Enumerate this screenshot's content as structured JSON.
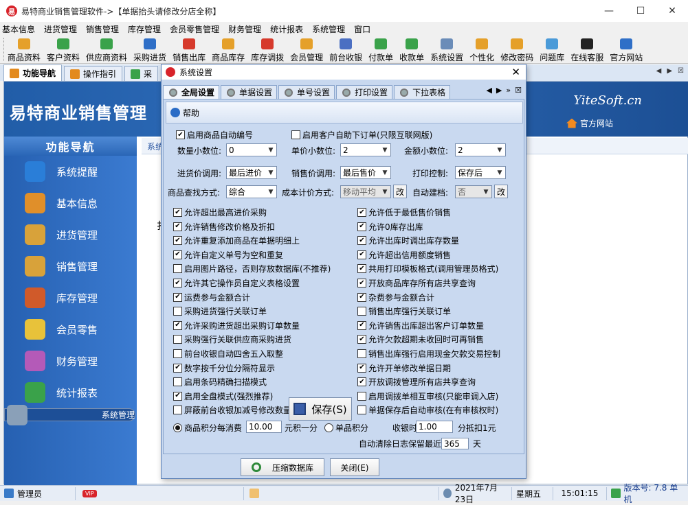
{
  "app": {
    "title": "易特商业销售管理软件->【单据抬头请修改分店全称】"
  },
  "menu": [
    "基本信息",
    "进货管理",
    "销售管理",
    "库存管理",
    "会员零售管理",
    "财务管理",
    "统计报表",
    "系统管理",
    "窗口"
  ],
  "toolbar": {
    "items": [
      {
        "label": "商品资料",
        "color": "#e5a02a"
      },
      {
        "label": "客户资料",
        "color": "#3aa24a"
      },
      {
        "label": "供应商资料",
        "color": "#3aa24a"
      },
      {
        "label": "采购进货",
        "color": "#2f6fc7"
      },
      {
        "label": "销售出库",
        "color": "#d63a2c"
      },
      {
        "label": "商品库存",
        "color": "#e5a02a"
      },
      {
        "label": "库存调拨",
        "color": "#d63a2c"
      },
      {
        "label": "会员管理",
        "color": "#e5a02a"
      },
      {
        "label": "前台收银",
        "color": "#4b6fc2"
      },
      {
        "label": "付款单",
        "color": "#3aa24a"
      },
      {
        "label": "收款单",
        "color": "#3aa24a"
      },
      {
        "label": "系统设置",
        "color": "#6a8cb8"
      },
      {
        "label": "个性化",
        "color": "#e5a02a"
      },
      {
        "label": "修改密码",
        "color": "#e5a02a"
      },
      {
        "label": "问题库",
        "color": "#4a9ad8"
      },
      {
        "label": "在线客服",
        "color": "#222"
      },
      {
        "label": "官方网站",
        "color": "#2f6fc7"
      }
    ]
  },
  "tabs": [
    "功能导航",
    "操作指引",
    "采"
  ],
  "banner": {
    "title": "易特商业销售管理",
    "brand": "YiteSoft.cn",
    "website": "官方网站"
  },
  "nav": {
    "header": "功能导航",
    "items": [
      {
        "label": "系统提醒",
        "color": "#2a7ed8"
      },
      {
        "label": "基本信息",
        "color": "#e08f2a"
      },
      {
        "label": "进货管理",
        "color": "#d8a23a"
      },
      {
        "label": "销售管理",
        "color": "#d8a23a"
      },
      {
        "label": "库存管理",
        "color": "#d05a2a"
      },
      {
        "label": "会员零售",
        "color": "#e8c23a"
      },
      {
        "label": "财务管理",
        "color": "#b45ab8"
      },
      {
        "label": "统计报表",
        "color": "#3aa24a"
      },
      {
        "label": "系统管理",
        "color": "#8aa0b8"
      }
    ],
    "subhead": "系统",
    "content_char": "扌"
  },
  "dialog": {
    "title": "系统设置",
    "tabs": [
      "全局设置",
      "单据设置",
      "单号设置",
      "打印设置",
      "下拉表格"
    ],
    "help": "帮助",
    "top_checks": {
      "auto_code": {
        "label": "启用商品自动编号",
        "checked": true
      },
      "self_order": {
        "label": "启用客户自助下订单(只限互联网版)",
        "checked": false
      }
    },
    "fields": {
      "qty_decimal": {
        "label": "数量小数位:",
        "value": "0"
      },
      "price_decimal": {
        "label": "单价小数位:",
        "value": "2"
      },
      "amount_decimal": {
        "label": "金额小数位:",
        "value": "2"
      },
      "purchase_price": {
        "label": "进货价调用:",
        "value": "最后进价"
      },
      "sale_price": {
        "label": "销售价调用:",
        "value": "最后售价"
      },
      "print_ctrl": {
        "label": "打印控制:",
        "value": "保存后"
      },
      "search_mode": {
        "label": "商品查找方式:",
        "value": "综合"
      },
      "cost_mode": {
        "label": "成本计价方式:",
        "value": "移动平均",
        "btn": "改"
      },
      "auto_file": {
        "label": "自动建档:",
        "value": "否",
        "btn": "改"
      }
    },
    "left_checks": [
      {
        "label": "允许超出最高进价采购",
        "checked": true
      },
      {
        "label": "允许销售修改价格及折扣",
        "checked": true
      },
      {
        "label": "允许重复添加商品在单据明细上",
        "checked": true
      },
      {
        "label": "允许自定义单号为空和重复",
        "checked": true
      },
      {
        "label": "启用图片路径，否则存放数据库(不推荐)",
        "checked": false
      },
      {
        "label": "允许其它操作员自定义表格设置",
        "checked": true
      },
      {
        "label": "运费参与金额合计",
        "checked": true
      },
      {
        "label": "采购进货强行关联订单",
        "checked": false
      },
      {
        "label": "允许采购进货超出采购订单数量",
        "checked": true
      },
      {
        "label": "采购强行关联供应商采购进货",
        "checked": false
      },
      {
        "label": "前台收银自动四舍五入取整",
        "checked": false
      },
      {
        "label": "数字按千分位分隔符显示",
        "checked": true
      },
      {
        "label": "启用条码精确扫描模式",
        "checked": false
      },
      {
        "label": "启用全盘模式(强烈推荐)",
        "checked": true
      },
      {
        "label": "屏蔽前台收银加减号修改数量功能",
        "checked": false
      }
    ],
    "right_checks": [
      {
        "label": "允许低于最低售价销售",
        "checked": true
      },
      {
        "label": "允许0库存出库",
        "checked": true
      },
      {
        "label": "允许出库时调出库存数量",
        "checked": true
      },
      {
        "label": "允许超出信用额度销售",
        "checked": true
      },
      {
        "label": "共用打印模板格式(调用管理员格式)",
        "checked": true
      },
      {
        "label": "开放商品库存所有店共享查询",
        "checked": true
      },
      {
        "label": "杂费参与金额合计",
        "checked": true
      },
      {
        "label": "销售出库强行关联订单",
        "checked": false
      },
      {
        "label": "允许销售出库超出客户订单数量",
        "checked": true
      },
      {
        "label": "允许欠款超期未收回时可再销售",
        "checked": true
      },
      {
        "label": "销售出库强行启用现金欠款交易控制",
        "checked": false
      },
      {
        "label": "允许开单修改单据日期",
        "checked": true
      },
      {
        "label": "开放调拨管理所有店共享查询",
        "checked": true
      },
      {
        "label": "启用调拨单相互审核(只能审调入店)",
        "checked": false
      },
      {
        "label": "单据保存后自动审核(在有审核权时)",
        "checked": false
      }
    ],
    "save_label": "保存(S)",
    "points": {
      "per_label": "商品积分每消费",
      "per_value": "10.00",
      "per_unit": "元积一分",
      "single_label": "单品积分",
      "cash_label": "收银时",
      "cash_value": "1.00",
      "cash_unit": "分抵扣1元"
    },
    "log": {
      "label": "自动清除日志保留最近",
      "value": "365",
      "unit": "天"
    },
    "compress_label": "压缩数据库",
    "close_label": "关闭(E)"
  },
  "status": {
    "user": "管理员",
    "vip": "VIP",
    "date": "2021年7月23日",
    "weekday": "星期五",
    "time": "15:01:15",
    "version": "版本号: 7.8 单机"
  }
}
